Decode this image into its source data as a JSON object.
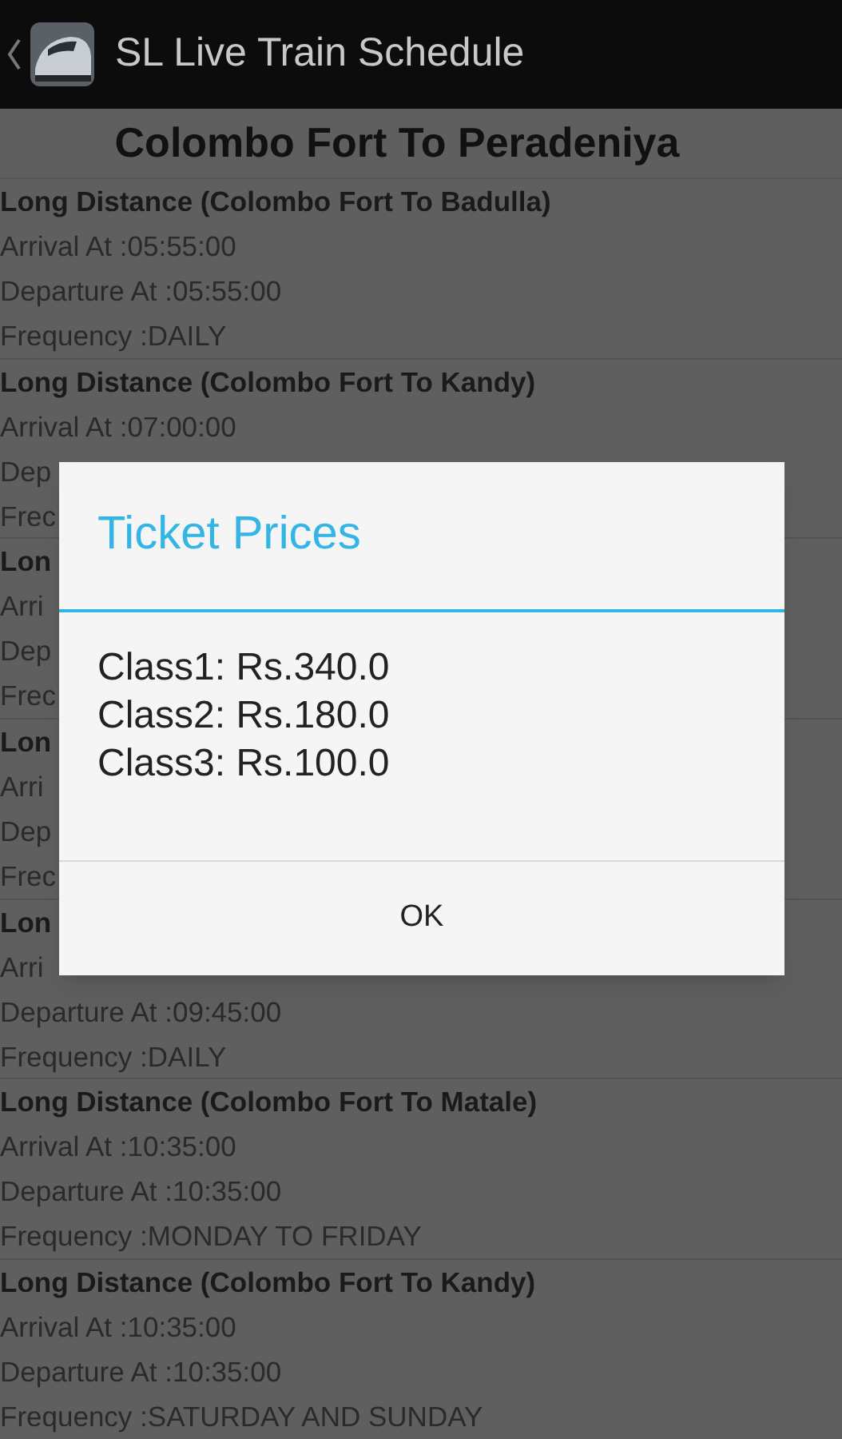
{
  "app_bar": {
    "title": "SL Live Train Schedule"
  },
  "route_title": "Colombo Fort To Peradeniya",
  "trains": [
    {
      "name": "Long Distance (Colombo Fort To Badulla)",
      "arrival": "Arrival At :05:55:00",
      "departure": "Departure At :05:55:00",
      "frequency": "Frequency :DAILY"
    },
    {
      "name": "Long Distance (Colombo Fort To Kandy)",
      "arrival": "Arrival At :07:00:00",
      "departure": "Dep",
      "frequency": "Frec"
    },
    {
      "name": "Lon",
      "arrival": "Arri",
      "departure": "Dep",
      "frequency": "Frec"
    },
    {
      "name": "Lon",
      "arrival": "Arri",
      "departure": "Dep",
      "frequency": "Frec"
    },
    {
      "name": "Lon",
      "arrival": "Arri",
      "departure": "Departure At :09:45:00",
      "frequency": "Frequency :DAILY"
    },
    {
      "name": "Long Distance (Colombo Fort To Matale)",
      "arrival": "Arrival At :10:35:00",
      "departure": "Departure At :10:35:00",
      "frequency": "Frequency :MONDAY TO FRIDAY"
    },
    {
      "name": "Long Distance (Colombo Fort To Kandy)",
      "arrival": "Arrival At :10:35:00",
      "departure": "Departure At :10:35:00",
      "frequency": "Frequency :SATURDAY AND SUNDAY"
    }
  ],
  "dialog": {
    "title": "Ticket Prices",
    "lines": [
      "Class1: Rs.340.0",
      "Class2: Rs.180.0",
      "Class3: Rs.100.0"
    ],
    "button": "OK"
  }
}
